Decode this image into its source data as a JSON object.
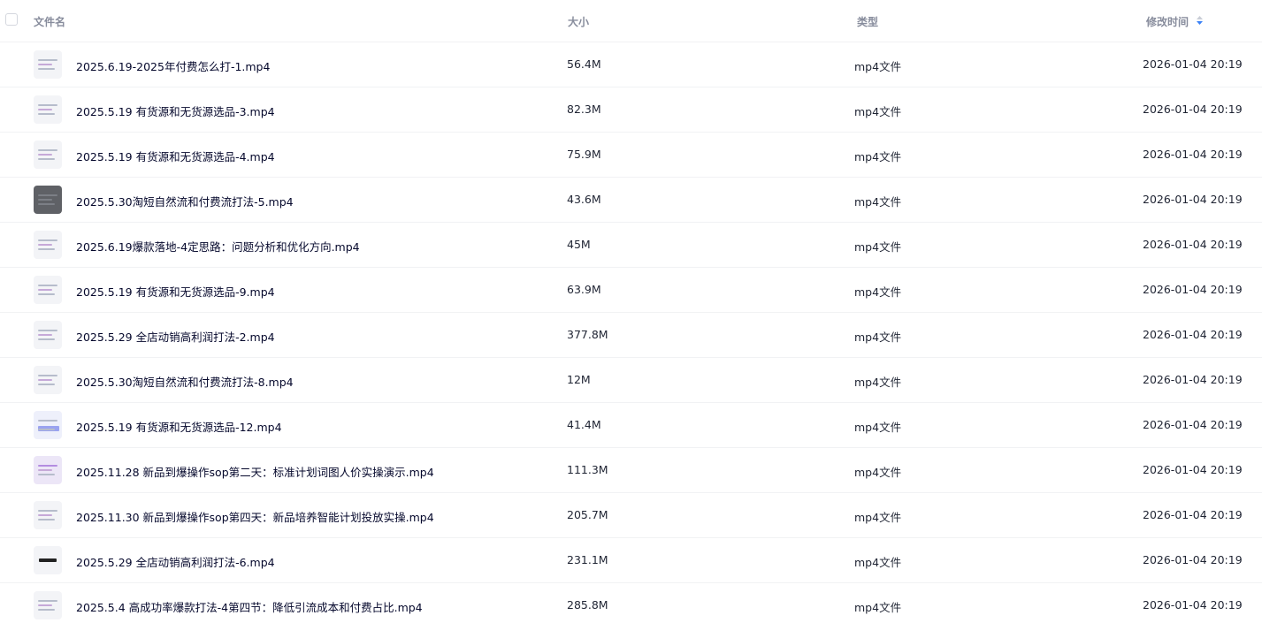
{
  "header": {
    "name_label": "文件名",
    "size_label": "大小",
    "type_label": "类型",
    "time_label": "修改时间",
    "sort_icon": "sort-descending-icon",
    "accent_color": "#3b82f6"
  },
  "files": [
    {
      "name": "2025.6.19-2025年付费怎么打-1.mp4",
      "size": "56.4M",
      "type": "mp4文件",
      "modified": "2026-01-04 20:19"
    },
    {
      "name": "2025.5.19 有货源和无货源选品-3.mp4",
      "size": "82.3M",
      "type": "mp4文件",
      "modified": "2026-01-04 20:19"
    },
    {
      "name": "2025.5.19 有货源和无货源选品-4.mp4",
      "size": "75.9M",
      "type": "mp4文件",
      "modified": "2026-01-04 20:19"
    },
    {
      "name": "2025.5.30淘短自然流和付费流打法-5.mp4",
      "size": "43.6M",
      "type": "mp4文件",
      "modified": "2026-01-04 20:19"
    },
    {
      "name": "2025.6.19爆款落地-4定思路：问题分析和优化方向.mp4",
      "size": "45M",
      "type": "mp4文件",
      "modified": "2026-01-04 20:19"
    },
    {
      "name": "2025.5.19 有货源和无货源选品-9.mp4",
      "size": "63.9M",
      "type": "mp4文件",
      "modified": "2026-01-04 20:19"
    },
    {
      "name": "2025.5.29 全店动销高利润打法-2.mp4",
      "size": "377.8M",
      "type": "mp4文件",
      "modified": "2026-01-04 20:19"
    },
    {
      "name": "2025.5.30淘短自然流和付费流打法-8.mp4",
      "size": "12M",
      "type": "mp4文件",
      "modified": "2026-01-04 20:19"
    },
    {
      "name": "2025.5.19 有货源和无货源选品-12.mp4",
      "size": "41.4M",
      "type": "mp4文件",
      "modified": "2026-01-04 20:19"
    },
    {
      "name": "2025.11.28 新品到爆操作sop第二天：标准计划词图人价实操演示.mp4",
      "size": "111.3M",
      "type": "mp4文件",
      "modified": "2026-01-04 20:19"
    },
    {
      "name": "2025.11.30 新品到爆操作sop第四天：新品培养智能计划投放实操.mp4",
      "size": "205.7M",
      "type": "mp4文件",
      "modified": "2026-01-04 20:19"
    },
    {
      "name": "2025.5.29 全店动销高利润打法-6.mp4",
      "size": "231.1M",
      "type": "mp4文件",
      "modified": "2026-01-04 20:19"
    },
    {
      "name": "2025.5.4 高成功率爆款打法-4第四节：降低引流成本和付费占比.mp4",
      "size": "285.8M",
      "type": "mp4文件",
      "modified": "2026-01-04 20:19"
    }
  ]
}
